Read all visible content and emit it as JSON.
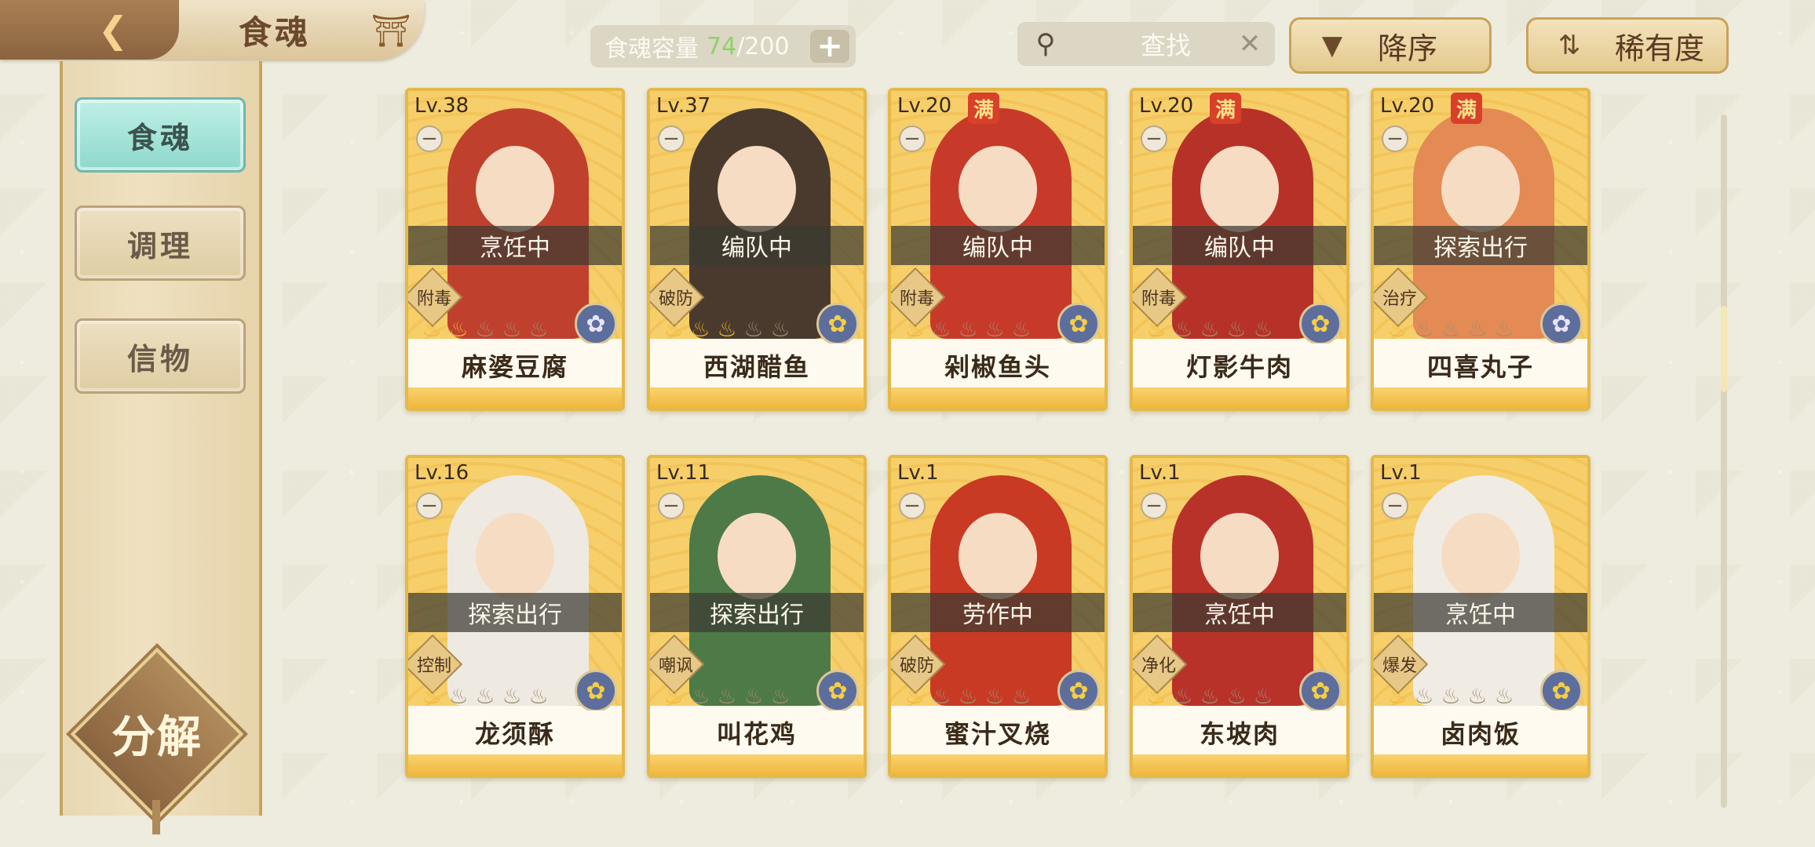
{
  "header": {
    "title": "食魂",
    "back_icon": "back-arrow-icon",
    "home_icon": "pavilion-icon",
    "capacity": {
      "label": "食魂容量",
      "used": "74",
      "total": "/200",
      "add_label": "+"
    },
    "search": {
      "placeholder": "查找",
      "clear_label": "✕"
    },
    "sort_order": "降序",
    "sort_by": "稀有度"
  },
  "sidebar": {
    "items": [
      {
        "label": "食魂",
        "active": true
      },
      {
        "label": "调理",
        "active": false
      },
      {
        "label": "信物",
        "active": false
      }
    ],
    "decompose_label": "分解"
  },
  "cards": [
    {
      "level": "Lv.38",
      "full": false,
      "status": "烹饪中",
      "tag": "附毒",
      "flames_on": 2,
      "emblem": "blue",
      "name": "麻婆豆腐"
    },
    {
      "level": "Lv.37",
      "full": false,
      "status": "编队中",
      "tag": "破防",
      "flames_on": 3,
      "emblem": "gold",
      "name": "西湖醋鱼"
    },
    {
      "level": "Lv.20",
      "full": true,
      "full_label": "满",
      "status": "编队中",
      "tag": "附毒",
      "flames_on": 1,
      "emblem": "gold",
      "name": "剁椒鱼头"
    },
    {
      "level": "Lv.20",
      "full": true,
      "full_label": "满",
      "status": "编队中",
      "tag": "附毒",
      "flames_on": 1,
      "emblem": "gold",
      "name": "灯影牛肉"
    },
    {
      "level": "Lv.20",
      "full": true,
      "full_label": "满",
      "status": "探索出行",
      "tag": "治疗",
      "flames_on": 1,
      "emblem": "blue",
      "name": "四喜丸子"
    },
    {
      "level": "Lv.16",
      "full": false,
      "status": "探索出行",
      "tag": "控制",
      "flames_on": 1,
      "emblem": "gold",
      "name": "龙须酥"
    },
    {
      "level": "Lv.11",
      "full": false,
      "status": "探索出行",
      "tag": "嘲讽",
      "flames_on": 1,
      "emblem": "gold",
      "name": "叫花鸡"
    },
    {
      "level": "Lv.1",
      "full": false,
      "status": "劳作中",
      "tag": "破防",
      "flames_on": 1,
      "emblem": "gold",
      "name": "蜜汁叉烧"
    },
    {
      "level": "Lv.1",
      "full": false,
      "status": "烹饪中",
      "tag": "净化",
      "flames_on": 1,
      "emblem": "gold",
      "name": "东坡肉"
    },
    {
      "level": "Lv.1",
      "full": false,
      "status": "烹饪中",
      "tag": "爆发",
      "flames_on": 1,
      "emblem": "gold",
      "name": "卤肉饭"
    }
  ],
  "colors": {
    "accent_gold": "#e5b948",
    "active_tab": "#8fd8cc",
    "capacity_used": "#8fd16a",
    "full_badge": "#d8402a"
  }
}
